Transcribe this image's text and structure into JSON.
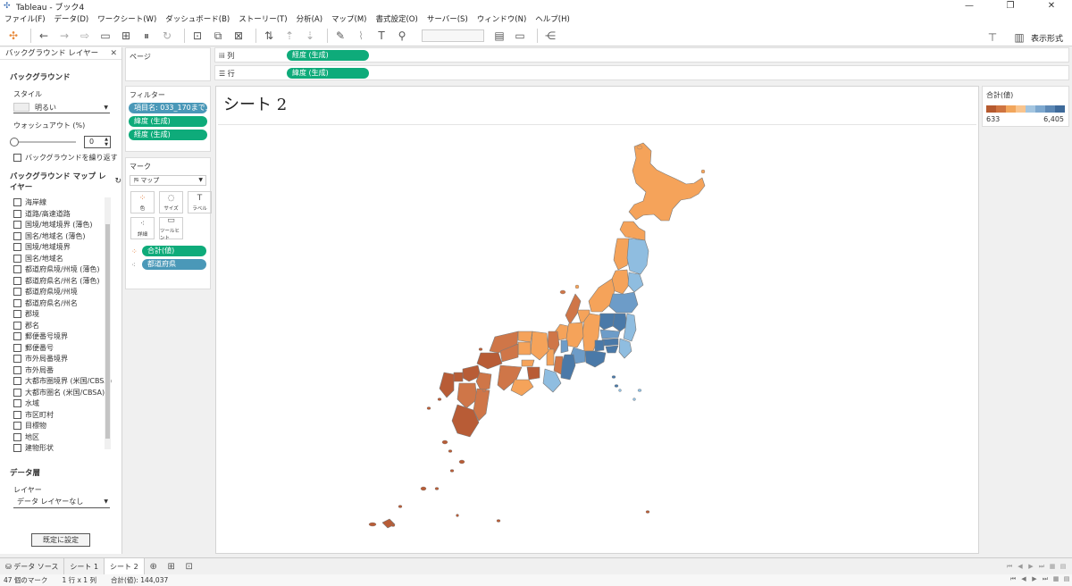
{
  "window": {
    "title": "Tableau - ブック4",
    "minimize": "—",
    "restore": "❐",
    "close": "✕"
  },
  "menu": [
    "ファイル(F)",
    "データ(D)",
    "ワークシート(W)",
    "ダッシュボード(B)",
    "ストーリー(T)",
    "分析(A)",
    "マップ(M)",
    "書式設定(O)",
    "サーバー(S)",
    "ウィンドウ(N)",
    "ヘルプ(H)"
  ],
  "toolbar": {
    "show_me": "表示形式"
  },
  "background_panel": {
    "header": "バックグラウンド レイヤー",
    "close": "✕",
    "section": "バックグラウンド",
    "style_label": "スタイル",
    "style_value": "明るい",
    "washout_label": "ウォッシュアウト (%)",
    "washout_value": "0",
    "repeat_label": "バックグラウンドを繰り返す",
    "layers_title": "バックグラウンド マップ レイヤー",
    "layers": [
      "海岸線",
      "道路/高速道路",
      "国境/地域境界 (薄色)",
      "国名/地域名 (薄色)",
      "国境/地域境界",
      "国名/地域名",
      "都道府県境/州境 (薄色)",
      "都道府県名/州名 (薄色)",
      "都道府県境/州境",
      "都道府県名/州名",
      "郡境",
      "郡名",
      "郵便番号境界",
      "郵便番号",
      "市外局番境界",
      "市外局番",
      "大都市圏境界 (米国/CBSA)",
      "大都市圏名 (米国/CBSA)",
      "水域",
      "市区町村",
      "目標物",
      "地区",
      "建物形状"
    ],
    "data_layer_section": "データ層",
    "data_layer_label": "レイヤー",
    "data_layer_value": "データ レイヤーなし",
    "default_button": "既定に設定"
  },
  "cards": {
    "pages": "ページ",
    "filters": "フィルター",
    "filter_pills": [
      {
        "label": "項目名: 033_170まで...",
        "color": "teal"
      },
      {
        "label": "緯度 (生成)",
        "color": "green"
      },
      {
        "label": "経度 (生成)",
        "color": "green"
      }
    ],
    "marks": "マーク",
    "mark_type": "マップ",
    "mark_buttons": [
      {
        "icon": "⁘",
        "label": "色"
      },
      {
        "icon": "◌",
        "label": "サイズ"
      },
      {
        "icon": "T",
        "label": "ラベル"
      },
      {
        "icon": "⁖",
        "label": "詳細"
      },
      {
        "icon": "▭",
        "label": "ツールヒント"
      }
    ],
    "enc_color": "合計(値)",
    "enc_detail": "都道府県"
  },
  "shelves": {
    "columns_label": "列",
    "columns_pill": "経度 (生成)",
    "rows_label": "行",
    "rows_pill": "緯度 (生成)"
  },
  "view": {
    "title": "シート 2"
  },
  "legend": {
    "title": "合計(値)",
    "min": "633",
    "max": "6,405",
    "colors": [
      "#b65a2f",
      "#cf7440",
      "#f2a65c",
      "#f9c48d",
      "#a3c5e0",
      "#7da8cf",
      "#5c88b5",
      "#3e6a9a"
    ]
  },
  "map_colors": {
    "orange": "#f5a35a",
    "dark_brown": "#b85c36",
    "rust": "#cf7648",
    "light_blue": "#8fbde0",
    "mid_blue": "#6d9cc8",
    "dark_blue": "#4a79a8",
    "border": "#7a7a7a"
  },
  "tabs": {
    "datasource": "データ ソース",
    "sheet1": "シート 1",
    "sheet2": "シート 2"
  },
  "status": {
    "marks": "47 個のマーク",
    "rowscols": "1 行 x 1 列",
    "sum": "合計(値): 144,037"
  }
}
